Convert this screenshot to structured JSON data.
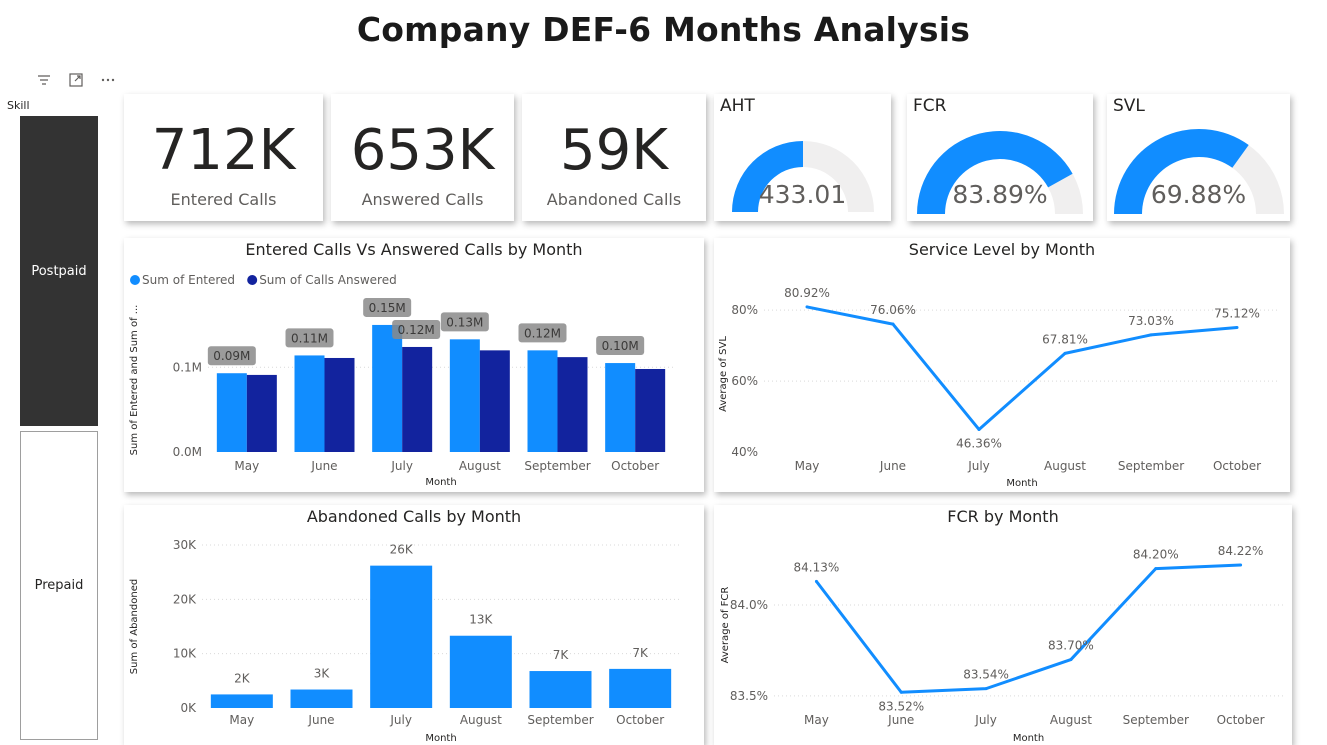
{
  "page_title": "Company DEF-6 Months Analysis",
  "slicer": {
    "label": "Skill",
    "items": [
      {
        "label": "Postpaid",
        "selected": true
      },
      {
        "label": "Prepaid",
        "selected": false
      }
    ],
    "icons": [
      "filter-icon",
      "focus-mode-icon",
      "more-options-icon"
    ]
  },
  "kpis": [
    {
      "value": "712K",
      "label": "Entered Calls"
    },
    {
      "value": "653K",
      "label": "Answered Calls"
    },
    {
      "value": "59K",
      "label": "Abandoned Calls"
    }
  ],
  "gauges": [
    {
      "title": "AHT",
      "value_text": "433.01",
      "fill_fraction": 0.5
    },
    {
      "title": "FCR",
      "value_text": "83.89%",
      "fill_fraction": 0.8389
    },
    {
      "title": "SVL",
      "value_text": "69.88%",
      "fill_fraction": 0.6988
    }
  ],
  "colors": {
    "primary_blue": "#118DFF",
    "dark_blue": "#12239E",
    "gauge_track": "#F0EFEF",
    "slicer_selected": "#333333"
  },
  "chart_data": [
    {
      "type": "bar",
      "title": "Entered Calls Vs Answered Calls by Month",
      "xlabel": "Month",
      "ylabel": "Sum of Entered and Sum of ...",
      "categories": [
        "May",
        "June",
        "July",
        "August",
        "September",
        "October"
      ],
      "series": [
        {
          "name": "Sum of Entered",
          "values": [
            0.093,
            0.114,
            0.15,
            0.133,
            0.12,
            0.105
          ],
          "labels": [
            "0.09M",
            "0.11M",
            "0.15M",
            "0.13M",
            "0.12M",
            "0.10M"
          ]
        },
        {
          "name": "Sum of Calls Answered",
          "values": [
            0.091,
            0.111,
            0.124,
            0.12,
            0.112,
            0.098
          ],
          "labels": [
            "",
            "",
            "0.12M",
            "",
            "",
            ""
          ]
        }
      ],
      "yticks": [
        {
          "value": 0,
          "label": "0.0M"
        },
        {
          "value": 0.1,
          "label": "0.1M"
        }
      ],
      "ylim": [
        0,
        0.17
      ],
      "legend": "top-left",
      "grid": true
    },
    {
      "type": "line",
      "title": "Service Level by Month",
      "xlabel": "Month",
      "ylabel": "Average of SVL",
      "categories": [
        "May",
        "June",
        "July",
        "August",
        "September",
        "October"
      ],
      "values": [
        80.92,
        76.06,
        46.36,
        67.81,
        73.03,
        75.12
      ],
      "labels": [
        "80.92%",
        "76.06%",
        "46.36%",
        "67.81%",
        "73.03%",
        "75.12%"
      ],
      "yticks": [
        {
          "value": 40,
          "label": "40%"
        },
        {
          "value": 60,
          "label": "60%"
        },
        {
          "value": 80,
          "label": "80%"
        }
      ],
      "ylim": [
        40,
        84
      ],
      "grid": true
    },
    {
      "type": "bar",
      "title": "Abandoned Calls by Month",
      "xlabel": "Month",
      "ylabel": "Sum of Abandoned",
      "categories": [
        "May",
        "June",
        "July",
        "August",
        "September",
        "October"
      ],
      "values": [
        2500,
        3400,
        26200,
        13300,
        6800,
        7200
      ],
      "labels": [
        "2K",
        "3K",
        "26K",
        "13K",
        "7K",
        "7K"
      ],
      "yticks": [
        {
          "value": 0,
          "label": "0K"
        },
        {
          "value": 10000,
          "label": "10K"
        },
        {
          "value": 20000,
          "label": "20K"
        },
        {
          "value": 30000,
          "label": "30K"
        }
      ],
      "ylim": [
        0,
        30000
      ],
      "grid": true
    },
    {
      "type": "line",
      "title": "FCR by Month",
      "xlabel": "Month",
      "ylabel": "Average of FCR",
      "categories": [
        "May",
        "June",
        "July",
        "August",
        "September",
        "October"
      ],
      "values": [
        84.13,
        83.52,
        83.54,
        83.7,
        84.2,
        84.22
      ],
      "labels": [
        "84.13%",
        "83.52%",
        "83.54%",
        "83.70%",
        "84.20%",
        "84.22%"
      ],
      "yticks": [
        {
          "value": 83.5,
          "label": "83.5%"
        },
        {
          "value": 84.0,
          "label": "84.0%"
        }
      ],
      "ylim": [
        83.45,
        84.33
      ],
      "grid": true
    }
  ]
}
